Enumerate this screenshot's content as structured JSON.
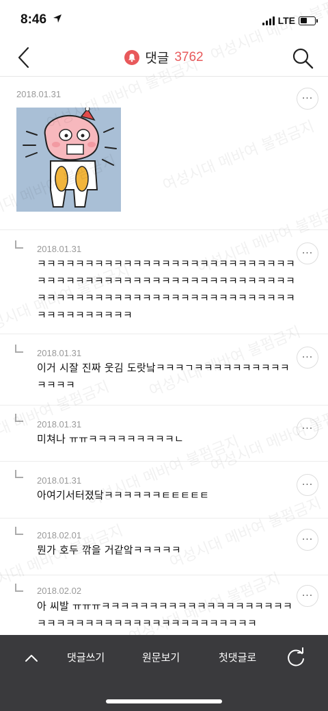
{
  "status_bar": {
    "time": "8:46",
    "network": "LTE",
    "battery_level": 0.45
  },
  "header": {
    "title": "댓글",
    "count": "3762",
    "accent": "#e8595b"
  },
  "watermark_text": "여성시대 메바여 불펌금지",
  "comments": [
    {
      "date": "2018.01.31",
      "text": "",
      "has_image": true
    },
    {
      "date": "2018.01.31",
      "text": "ㅋㅋㅋㅋㅋㅋㅋㅋㅋㅋㅋㅋㅋㅋㅋㅋㅋㅋㅋㅋㅋㅋㅋㅋㅋㅋㅋㅋㅋㅋㅋㅋㅋㅋㅋㅋㅋㅋㅋㅋㅋㅋㅋㅋㅋㅋㅋㅋㅋㅋㅋㅋㅋㅋㅋㅋㅋㅋㅋㅋㅋㅋㅋㅋㅋㅋㅋㅋㅋㅋㅋㅋㅋㅋㅋㅋㅋㅋㅋㅋㅋㅋㅋㅋㅋㅋㅋㅋㅋㅋㅋ"
    },
    {
      "date": "2018.01.31",
      "text": "이거 시잘 진짜 웃김 도랏낰ㅋㅋㅋㄱㅋㅋㅋㅋㅋㅋㅋㅋㅋㅋㅋㅋㅋㅋ"
    },
    {
      "date": "2018.01.31",
      "text": "미쳐나 ㅠㅠㅋㅋㅋㅋㅋㅋㅋㅋㅋㄴ"
    },
    {
      "date": "2018.01.31",
      "text": "아여기서터졌닼ㅋㅋㅋㅋㅋㅋㅌㅌㅌㅌㅌ"
    },
    {
      "date": "2018.02.01",
      "text": "뭔가 호두 깎을 거같앜ㅋㅋㅋㅋㅋ"
    },
    {
      "date": "2018.02.02",
      "text": "아 씨발 ㅠㅠㅠㅋㅋㅋㅋㅋㅋㅋㅋㅋㅋㅋㅋㅋㅋㅋㅋㅋㅋㅋㅋㅋㅋㅋㅋㅋㅋㅋㅋㅋㅋㅋㅋㅋㅋㅋㅋㅋㅋㅋㅋㅋㅋㅋ"
    }
  ],
  "more_label": "···",
  "bottom_bar": {
    "write": "댓글쓰기",
    "original": "원문보기",
    "first": "첫댓글로"
  }
}
